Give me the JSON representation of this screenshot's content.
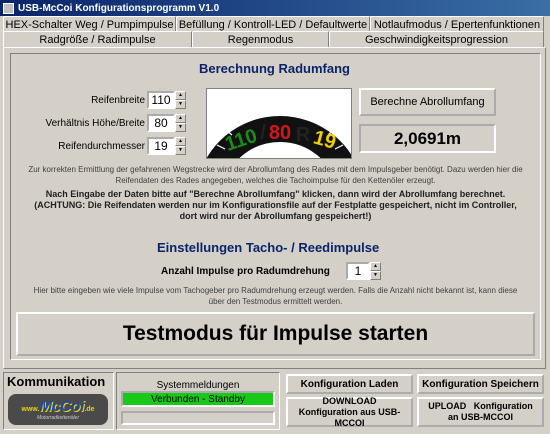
{
  "window": {
    "title": "USB-McCoi Konfigurationsprogramm V1.0"
  },
  "tabs_row1": [
    {
      "label": "HEX-Schalter Weg / Pumpimpulse"
    },
    {
      "label": "Befüllung / Kontroll-LED / Defaultwerte"
    },
    {
      "label": "Notlaufmodus / Epertenfunktionen"
    }
  ],
  "tabs_row2": [
    {
      "label": "Radgröße / Radimpulse"
    },
    {
      "label": "Regenmodus"
    },
    {
      "label": "Geschwindigkeitsprogression"
    }
  ],
  "circumference": {
    "heading": "Berechnung Radumfang",
    "width_label": "Reifenbreite",
    "width_value": "110",
    "ratio_label": "Verhältnis Höhe/Breite",
    "ratio_value": "80",
    "diameter_label": "Reifendurchmesser",
    "diameter_value": "19",
    "tyre_text": {
      "width": "110",
      "sep": "/",
      "ratio": "80",
      "r": "R",
      "diameter": "19"
    },
    "calc_button": "Berechne Abrollumfang",
    "result": "2,0691m",
    "note": "Zur korrekten Ermittlung der gefahrenen Wegstrecke wird der Abrollumfang des Rades mit dem Impulsgeber benötigt. Dazu werden hier die Reifendaten des Rades angegeben, welches die Tachoimpulse für den Kettenöler erzeugt.",
    "note_bold": "Nach Eingabe der Daten bitte auf \"Berechne Abrollumfang\" klicken, dann wird der Abrollumfang berechnet. (ACHTUNG: Die Reifendaten werden nur im Konfigurationsfile auf der Festplatte gespeichert, nicht im Controller, dort wird nur der Abrollumfang gespeichert!)"
  },
  "impulses": {
    "heading": "Einstellungen Tacho- / Reedimpulse",
    "count_label": "Anzahl Impulse pro Radumdrehung",
    "count_value": "1",
    "note": "Hier bitte eingeben wie viele Impulse vom Tachogeber pro Radumdrehung erzeugt werden. Falls die Anzahl nicht bekannt ist, kann diese über den Testmodus ermittelt werden.",
    "test_button": "Testmodus für Impulse starten"
  },
  "bottom": {
    "comm_title": "Kommunikation",
    "logo_text": "McCoi",
    "logo_prefix": "www.",
    "logo_suffix": ".de",
    "logo_tagline": "Motorradkettenöler",
    "sys_title": "Systemmeldungen",
    "sys_status": "Verbunden - Standby",
    "load_button": "Konfiguration Laden",
    "save_button": "Konfiguration Speichern",
    "download_button": "DOWNLOAD Konfiguration aus USB-MCCOI",
    "upload_button": "UPLOAD   Konfiguration an USB-MCCOI"
  },
  "colors": {
    "title_bar": "#0a246a",
    "heading": "#0a246a",
    "status_ok": "#19c919",
    "tyre_green": "#1a8c1a",
    "tyre_red": "#d01818",
    "tyre_yellow": "#f0d000"
  }
}
